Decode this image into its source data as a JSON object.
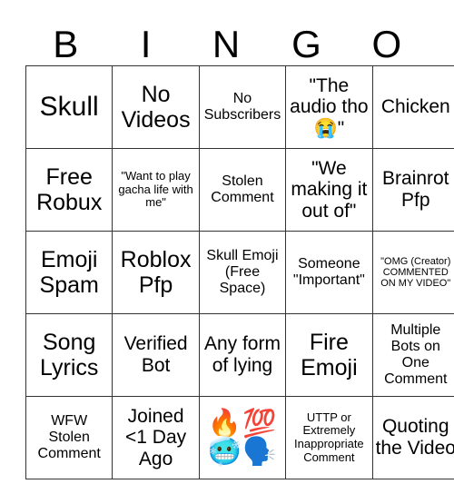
{
  "card": {
    "header_letters": [
      "B",
      "I",
      "N",
      "G",
      "O"
    ],
    "rows": [
      [
        {
          "text": "Skull",
          "size": "fs-xl"
        },
        {
          "text": "No Videos",
          "size": "fs-lg"
        },
        {
          "text": "No Subscribers",
          "size": "fs-sm"
        },
        {
          "text": "\"The audio tho 😭\"",
          "size": "fs-md"
        },
        {
          "text": "Chicken",
          "size": "fs-md"
        }
      ],
      [
        {
          "text": "Free Robux",
          "size": "fs-lg"
        },
        {
          "text": "\"Want to play gacha life with me\"",
          "size": "fs-xs"
        },
        {
          "text": "Stolen Comment",
          "size": "fs-sm"
        },
        {
          "text": "\"We making it out of\"",
          "size": "fs-md"
        },
        {
          "text": "Brainrot Pfp",
          "size": "fs-md"
        }
      ],
      [
        {
          "text": "Emoji Spam",
          "size": "fs-lg"
        },
        {
          "text": "Roblox Pfp",
          "size": "fs-lg"
        },
        {
          "text": "Skull Emoji (Free Space)",
          "size": "fs-sm"
        },
        {
          "text": "Someone \"Important\"",
          "size": "fs-sm"
        },
        {
          "text": "\"OMG (Creator) COMMENTED ON MY VIDEO\"",
          "size": "fs-xxs"
        }
      ],
      [
        {
          "text": "Song Lyrics",
          "size": "fs-lg"
        },
        {
          "text": "Verified Bot",
          "size": "fs-md"
        },
        {
          "text": "Any form of lying",
          "size": "fs-md"
        },
        {
          "text": "Fire Emoji",
          "size": "fs-lg"
        },
        {
          "text": "Multiple Bots on One Comment",
          "size": "fs-sm"
        }
      ],
      [
        {
          "text": "WFW Stolen Comment",
          "size": "fs-sm"
        },
        {
          "text": "Joined <1 Day Ago",
          "size": "fs-md"
        },
        {
          "text": "🔥💯🥶🗣️",
          "size": "emoji-cell"
        },
        {
          "text": "UTTP or Extremely Inappropriate Comment",
          "size": "fs-xs"
        },
        {
          "text": "Quoting the Video",
          "size": "fs-md"
        }
      ]
    ]
  }
}
